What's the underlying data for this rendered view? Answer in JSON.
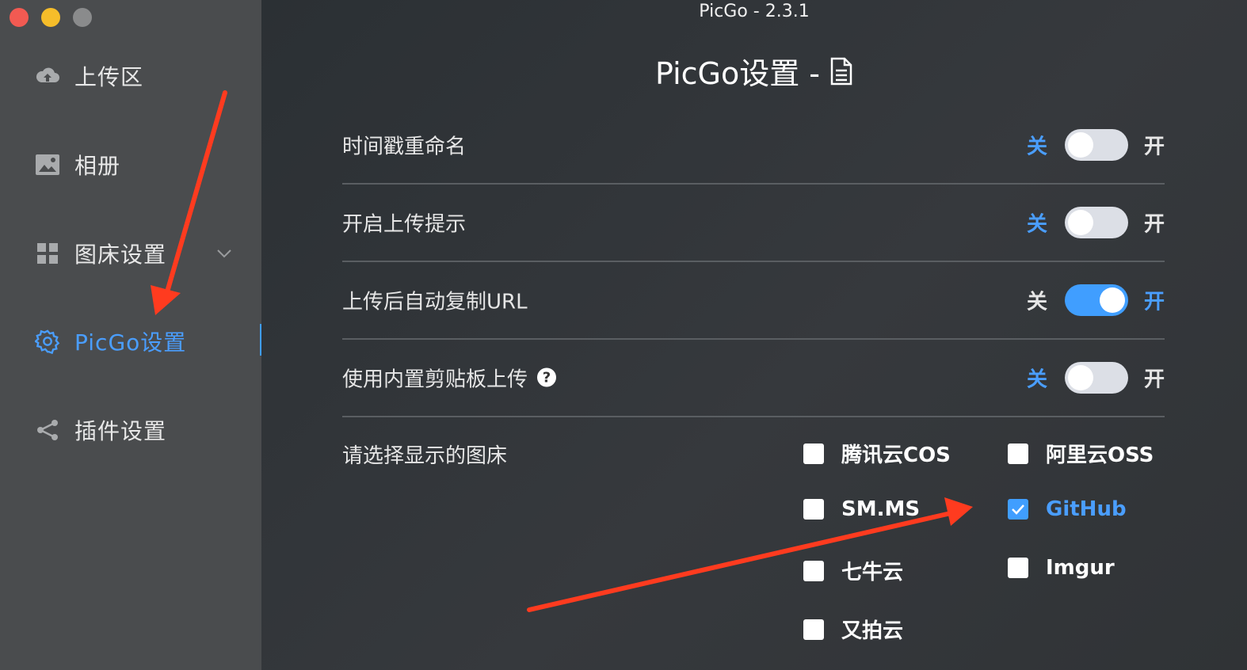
{
  "window": {
    "title": "PicGo - 2.3.1"
  },
  "colors": {
    "accent": "#409eff",
    "sidebar": "#4a4c4e",
    "main": "#2f3336",
    "annotation_arrow": "#ff3b1f"
  },
  "sidebar": {
    "items": [
      {
        "label": "上传区",
        "icon": "cloud-upload-icon"
      },
      {
        "label": "相册",
        "icon": "image-icon"
      },
      {
        "label": "图床设置",
        "icon": "grid-icon"
      },
      {
        "label": "PicGo设置",
        "icon": "gear-icon",
        "active": true
      },
      {
        "label": "插件设置",
        "icon": "share-icon"
      }
    ]
  },
  "page": {
    "title": "PicGo设置 -",
    "title_icon": "document-icon"
  },
  "settings": [
    {
      "label": "时间戳重命名",
      "off": "关",
      "on": "开",
      "value": false
    },
    {
      "label": "开启上传提示",
      "off": "关",
      "on": "开",
      "value": false
    },
    {
      "label": "上传后自动复制URL",
      "off": "关",
      "on": "开",
      "value": true
    },
    {
      "label": "使用内置剪贴板上传",
      "off": "关",
      "on": "开",
      "value": false,
      "help_icon": "question-icon",
      "help_text": "?"
    }
  ],
  "image_hosts": {
    "label": "请选择显示的图床",
    "options": [
      {
        "label": "腾讯云COS",
        "checked": false
      },
      {
        "label": "阿里云OSS",
        "checked": false
      },
      {
        "label": "SM.MS",
        "checked": false
      },
      {
        "label": "GitHub",
        "checked": true
      },
      {
        "label": "七牛云",
        "checked": false
      },
      {
        "label": "Imgur",
        "checked": false
      },
      {
        "label": "又拍云",
        "checked": false
      }
    ]
  }
}
